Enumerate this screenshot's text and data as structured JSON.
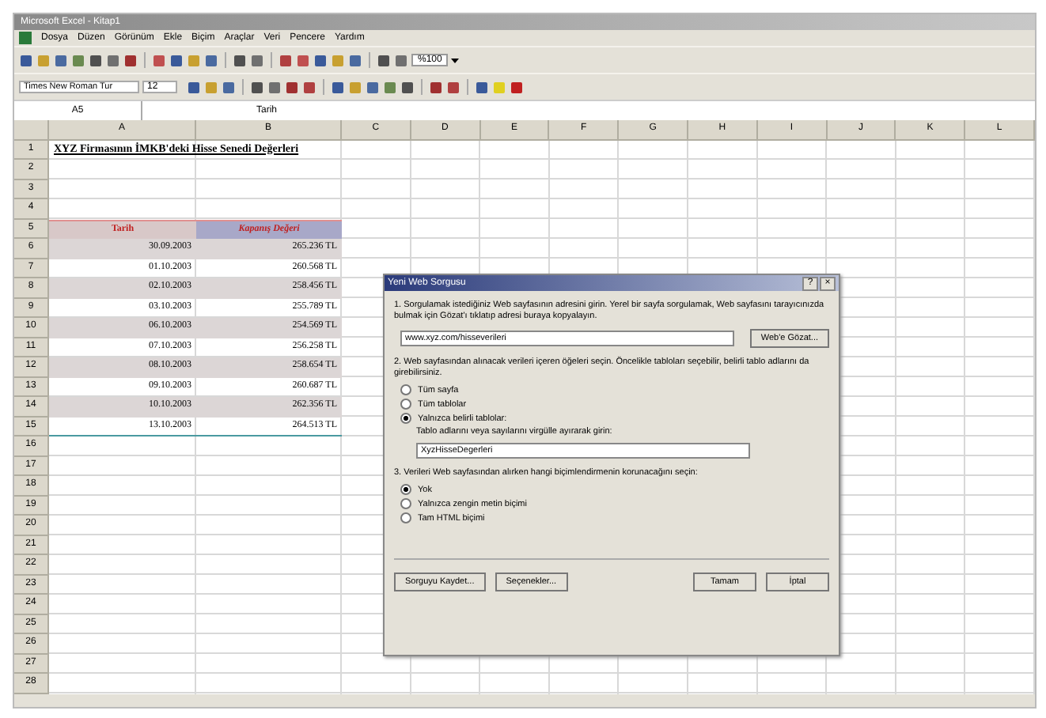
{
  "window": {
    "title": "Microsoft Excel - Kitap1"
  },
  "menu": [
    "Dosya",
    "Düzen",
    "Görünüm",
    "Ekle",
    "Biçim",
    "Araçlar",
    "Veri",
    "Pencere",
    "Yardım"
  ],
  "toolbar": {
    "zoom": "%100"
  },
  "format_toolbar": {
    "font": "Times New Roman Tur",
    "size": "12"
  },
  "formula_bar": {
    "name_box": "A5",
    "content": "Tarih"
  },
  "columns": [
    "A",
    "B",
    "C",
    "D",
    "E",
    "F",
    "G",
    "H",
    "I",
    "J",
    "K",
    "L"
  ],
  "row_numbers": [
    "1",
    "2",
    "3",
    "4",
    "5",
    "6",
    "7",
    "8",
    "9",
    "10",
    "11",
    "12",
    "13",
    "14",
    "15",
    "16",
    "17",
    "18",
    "19",
    "20",
    "21",
    "22",
    "23",
    "24",
    "25",
    "26",
    "27",
    "28"
  ],
  "sheet": {
    "title": "XYZ Firmasının İMKB'deki Hisse Senedi Değerleri",
    "headers": [
      "Tarih",
      "Kapanış Değeri"
    ],
    "rows": [
      {
        "date": "30.09.2003",
        "value": "265.236 TL"
      },
      {
        "date": "01.10.2003",
        "value": "260.568 TL"
      },
      {
        "date": "02.10.2003",
        "value": "258.456 TL"
      },
      {
        "date": "03.10.2003",
        "value": "255.789 TL"
      },
      {
        "date": "06.10.2003",
        "value": "254.569 TL"
      },
      {
        "date": "07.10.2003",
        "value": "256.258 TL"
      },
      {
        "date": "08.10.2003",
        "value": "258.654 TL"
      },
      {
        "date": "09.10.2003",
        "value": "260.687 TL"
      },
      {
        "date": "10.10.2003",
        "value": "262.356 TL"
      },
      {
        "date": "13.10.2003",
        "value": "264.513 TL"
      }
    ]
  },
  "dialog": {
    "title": "Yeni Web Sorgusu",
    "help": "?",
    "close": "×",
    "step1": "1. Sorgulamak istediğiniz Web sayfasının adresini girin. Yerel bir sayfa sorgulamak, Web sayfasını tarayıcınızda bulmak için Gözat'ı tıklatıp adresi buraya kopyalayın.",
    "address": "www.xyz.com/hisseverileri",
    "browse": "Web'e Gözat...",
    "step2": "2. Web sayfasından alınacak verileri içeren öğeleri seçin. Öncelikle tabloları seçebilir, belirli tablo adlarını da girebilirsiniz.",
    "options2": [
      {
        "label": "Tüm sayfa",
        "selected": false
      },
      {
        "label": "Tüm tablolar",
        "selected": false
      },
      {
        "label": "Yalnızca belirli tablolar:",
        "selected": true
      }
    ],
    "tables_label": "Tablo adlarını veya sayılarını virgülle ayırarak girin:",
    "tables": "XyzHisseDegerleri",
    "step3": "3. Verileri Web sayfasından alırken hangi biçimlendirmenin korunacağını seçin:",
    "options3": [
      {
        "label": "Yok",
        "selected": true
      },
      {
        "label": "Yalnızca zengin metin biçimi",
        "selected": false
      },
      {
        "label": "Tam HTML biçimi",
        "selected": false
      }
    ],
    "buttons": [
      "Sorguyu Kaydet...",
      "Seçenekler...",
      "Tamam",
      "İptal"
    ]
  }
}
